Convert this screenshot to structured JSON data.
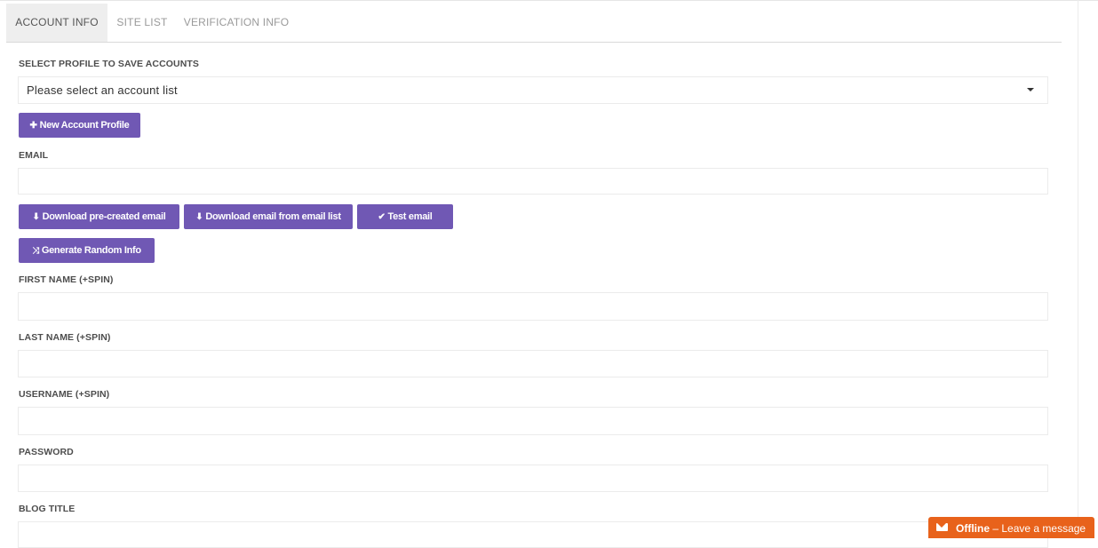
{
  "tabs": [
    {
      "label": "ACCOUNT INFO",
      "active": true
    },
    {
      "label": "SITE LIST",
      "active": false
    },
    {
      "label": "VERIFICATION INFO",
      "active": false
    }
  ],
  "profile": {
    "label": "SELECT PROFILE TO SAVE ACCOUNTS",
    "selected": "Please select an account list",
    "new_button": "New Account Profile"
  },
  "email": {
    "label": "EMAIL",
    "value": "",
    "buttons": {
      "download_precreated": "Download pre-created email",
      "download_from_list": "Download email from email list",
      "test": "Test email"
    }
  },
  "generate_button": "Generate Random Info",
  "fields": {
    "first_name": {
      "label": "FIRST NAME (+SPIN)",
      "value": ""
    },
    "last_name": {
      "label": "LAST NAME (+SPIN)",
      "value": ""
    },
    "username": {
      "label": "USERNAME (+SPIN)",
      "value": ""
    },
    "password": {
      "label": "PASSWORD",
      "value": ""
    },
    "blog_title": {
      "label": "BLOG TITLE",
      "value": ""
    }
  },
  "chat_widget": {
    "status": "Offline",
    "separator": "–",
    "message": "Leave a message"
  },
  "colors": {
    "accent": "#7058b4",
    "chat": "#e8621b",
    "active_tab": "#eeeeee"
  }
}
